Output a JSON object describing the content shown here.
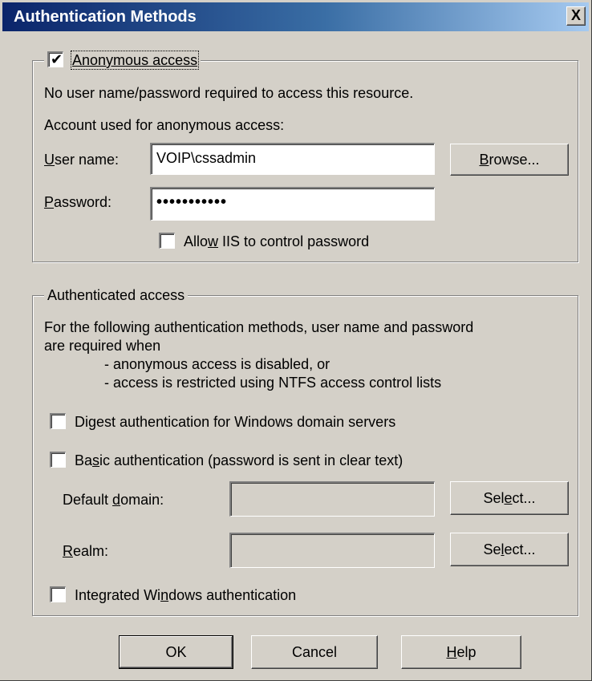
{
  "title": "Authentication Methods",
  "close_glyph": "X",
  "anonymous": {
    "checkbox_checked": true,
    "label": "Anonymous access",
    "desc1": "No user name/password required to access this resource.",
    "desc2": "Account used for anonymous access:",
    "username_label_u": "U",
    "username_label_rest": "ser name:",
    "username_value": "VOIP\\cssadmin",
    "browse_u": "B",
    "browse_rest": "rowse...",
    "password_label_u": "P",
    "password_label_rest": "assword:",
    "password_value": "•••••••••••",
    "allow_iis_pre": "Allo",
    "allow_iis_u": "w",
    "allow_iis_post": " IIS to control password",
    "allow_iis_checked": false
  },
  "authenticated": {
    "legend": "Authenticated access",
    "desc_line1": "For the following authentication methods, user name and password",
    "desc_line2": "are required when",
    "desc_bullet1": "- anonymous access is disabled, or",
    "desc_bullet2": "- access is restricted using NTFS access control lists",
    "digest_pre": "Di",
    "digest_u": "g",
    "digest_post": "est authentication for Windows domain servers",
    "digest_checked": false,
    "basic_pre": "Ba",
    "basic_u": "s",
    "basic_post": "ic authentication (password is sent in clear text)",
    "basic_checked": false,
    "default_domain_pre": "Default ",
    "default_domain_u": "d",
    "default_domain_post": "omain:",
    "default_domain_value": "",
    "select1_pre": "Sel",
    "select1_u": "e",
    "select1_post": "ct...",
    "realm_u": "R",
    "realm_post": "ealm:",
    "realm_value": "",
    "select2_pre": "Se",
    "select2_u": "l",
    "select2_post": "ect...",
    "integrated_pre": "Integrated Wi",
    "integrated_u": "n",
    "integrated_post": "dows authentication",
    "integrated_checked": false
  },
  "buttons": {
    "ok": "OK",
    "cancel": "Cancel",
    "help_u": "H",
    "help_post": "elp"
  }
}
